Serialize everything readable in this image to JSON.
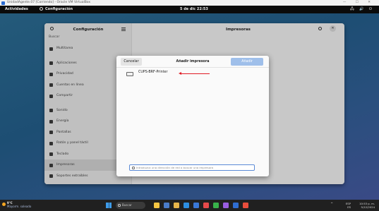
{
  "vbox_window": {
    "title": "UnidadAgente.07 [Corriendo] - Oracle VM VirtualBox",
    "controls": "— ☐ ✕"
  },
  "topbar": {
    "activities": "Actividades",
    "app_name": "Configuración",
    "clock": "5 de dic 22:53",
    "tray": "🖧 🔊 ⏻"
  },
  "settings": {
    "sidebar_title": "Configuración",
    "search_label": "Buscar",
    "page_title": "Impresoras",
    "sidebar_items": [
      {
        "label": "Multitarea",
        "icon": "multitask-icon"
      },
      {
        "label": "Aplicaciones",
        "icon": "apps-icon"
      },
      {
        "label": "Privacidad",
        "icon": "privacy-icon"
      },
      {
        "label": "Cuentas en línea",
        "icon": "online-accounts-icon"
      },
      {
        "label": "Compartir",
        "icon": "share-icon"
      },
      {
        "label": "Sonido",
        "icon": "sound-icon"
      },
      {
        "label": "Energía",
        "icon": "power-icon"
      },
      {
        "label": "Pantallas",
        "icon": "display-icon"
      },
      {
        "label": "Ratón y panel táctil",
        "icon": "mouse-icon"
      },
      {
        "label": "Teclado",
        "icon": "keyboard-icon"
      },
      {
        "label": "Impresoras",
        "icon": "printer-icon"
      },
      {
        "label": "Soportes extraíbles",
        "icon": "removable-media-icon"
      }
    ]
  },
  "dialog": {
    "cancel_label": "Cancelar",
    "title": "Añadir impresora",
    "add_label": "Añadir",
    "printer_name": "CUPS-BRF-Printer",
    "address_placeholder": "Introduzca una dirección de red o buscar una impresora"
  },
  "taskbar": {
    "weather_temp": "9°C",
    "weather_desc": "Mayorm. soleado",
    "search_label": "Buscar",
    "lang_line1": "ESP",
    "lang_line2": "ES",
    "time": "10:53 p. m.",
    "date": "5/12/2024"
  },
  "colors": {
    "accent": "#9fbfea",
    "arrow": "#e01b24",
    "taskbar": "#202020"
  }
}
